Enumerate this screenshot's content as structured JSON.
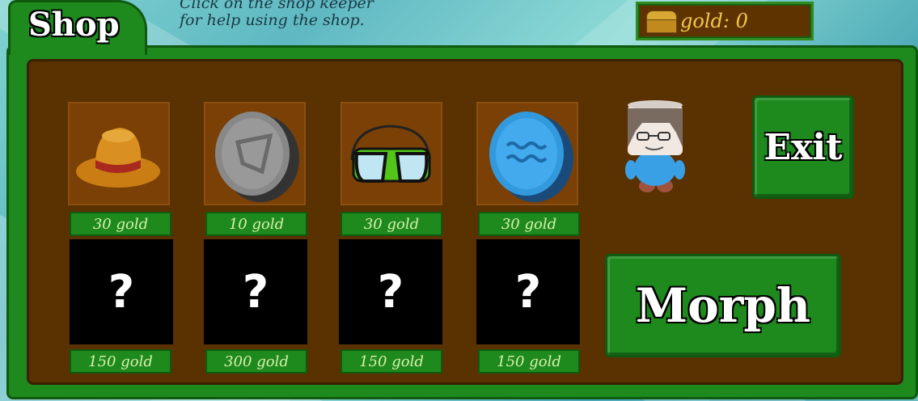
{
  "header": {
    "tab_title": "Shop",
    "hint_line1": "Click on the shop keeper",
    "hint_line2": "for help using the shop.",
    "gold_label": "gold: 0"
  },
  "items": [
    {
      "icon": "hat-icon",
      "price": "30 gold"
    },
    {
      "icon": "gray-coin-icon",
      "price": "10 gold"
    },
    {
      "icon": "goggles-icon",
      "price": "30 gold"
    },
    {
      "icon": "blue-coin-icon",
      "price": "30 gold"
    }
  ],
  "mystery_items": [
    {
      "symbol": "?",
      "price": "150 gold"
    },
    {
      "symbol": "?",
      "price": "300 gold"
    },
    {
      "symbol": "?",
      "price": "150 gold"
    },
    {
      "symbol": "?",
      "price": "150 gold"
    }
  ],
  "buttons": {
    "exit": "Exit",
    "morph": "Morph"
  },
  "colors": {
    "panel_green": "#1e8a1e",
    "inner_brown": "#5a3100",
    "gold_text": "#f2c84a"
  }
}
